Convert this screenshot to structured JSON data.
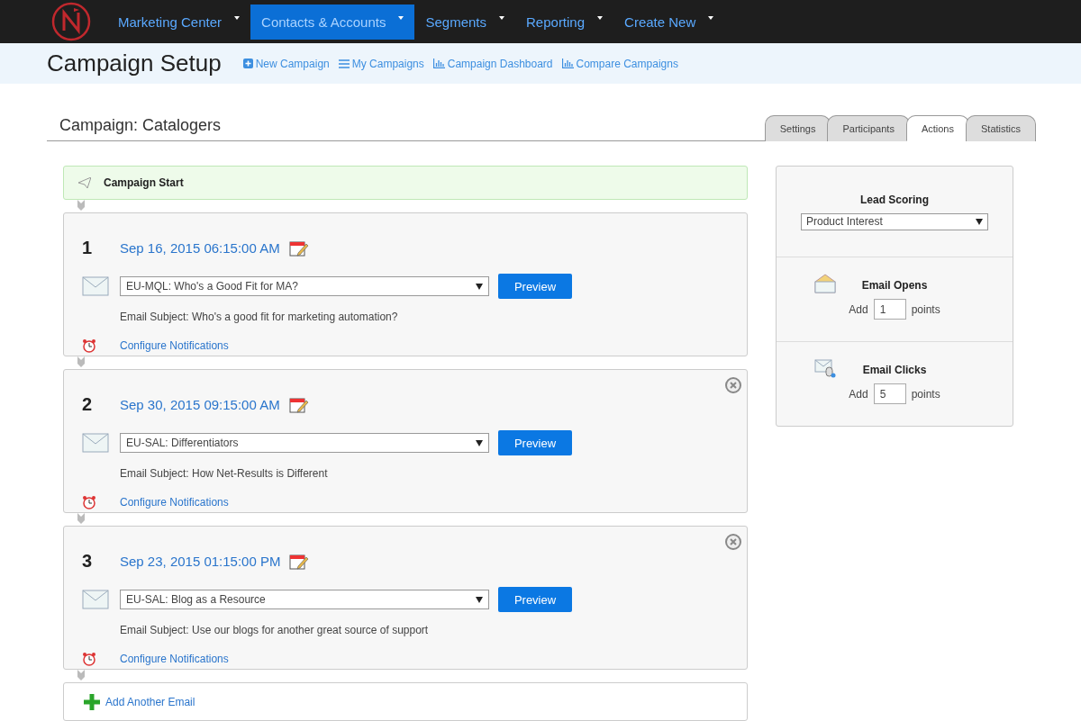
{
  "nav": [
    {
      "label": "Marketing Center",
      "selected": false
    },
    {
      "label": "Contacts & Accounts",
      "selected": true
    },
    {
      "label": "Segments",
      "selected": false
    },
    {
      "label": "Reporting",
      "selected": false
    },
    {
      "label": "Create New",
      "selected": false
    }
  ],
  "page_title": "Campaign Setup",
  "header_links": [
    {
      "label": "New Campaign",
      "kind": "plus"
    },
    {
      "label": "My Campaigns",
      "kind": "list"
    },
    {
      "label": "Campaign Dashboard",
      "kind": "chart"
    },
    {
      "label": "Compare Campaigns",
      "kind": "chart"
    }
  ],
  "campaign_title": "Campaign: Catalogers",
  "tabs": [
    {
      "label": "Settings",
      "selected": false
    },
    {
      "label": "Participants",
      "selected": false
    },
    {
      "label": "Actions",
      "selected": true
    },
    {
      "label": "Statistics",
      "selected": false
    }
  ],
  "start_label": "Campaign Start",
  "steps": [
    {
      "number": "1",
      "date": "Sep 16, 2015 06:15:00 AM",
      "email": "EU-MQL: Who's a Good Fit for MA?",
      "preview": "Preview",
      "subject": "Email Subject: Who's a good fit for marketing automation?",
      "notifications": "Configure Notifications",
      "removable": false
    },
    {
      "number": "2",
      "date": "Sep 30, 2015 09:15:00 AM",
      "email": "EU-SAL: Differentiators",
      "preview": "Preview",
      "subject": "Email Subject: How Net-Results is Different",
      "notifications": "Configure Notifications",
      "removable": true
    },
    {
      "number": "3",
      "date": "Sep 23, 2015 01:15:00 PM",
      "email": "EU-SAL: Blog as a Resource",
      "preview": "Preview",
      "subject": "Email Subject: Use our blogs for another great source of support",
      "notifications": "Configure Notifications",
      "removable": true
    }
  ],
  "add_email": "Add Another Email",
  "lead_scoring": {
    "title": "Lead Scoring",
    "select": "Product Interest",
    "rules": [
      {
        "kind": "opens",
        "title": "Email Opens",
        "prefix": "Add",
        "value": "1",
        "suffix": "points"
      },
      {
        "kind": "clicks",
        "title": "Email Clicks",
        "prefix": "Add",
        "value": "5",
        "suffix": "points"
      }
    ]
  }
}
